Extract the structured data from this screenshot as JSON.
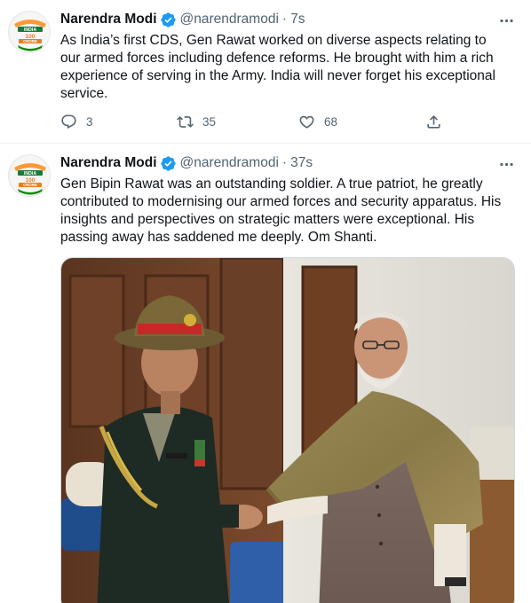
{
  "tweets": [
    {
      "author_name": "Narendra Modi",
      "handle": "@narendramodi",
      "separator": "·",
      "time": "7s",
      "text": "As India’s first CDS, Gen Rawat worked on diverse aspects relating to our armed forces including defence reforms. He brought with him a rich experience of serving in the Army. India will never forget his exceptional service.",
      "replies": "3",
      "retweets": "35",
      "likes": "68"
    },
    {
      "author_name": "Narendra Modi",
      "handle": "@narendramodi",
      "separator": "·",
      "time": "37s",
      "text": "Gen Bipin Rawat was an outstanding soldier. A true patriot, he greatly contributed to modernising our armed forces and security apparatus. His insights and perspectives on strategic matters were exceptional. His passing away has saddened me deeply. Om Shanti."
    }
  ],
  "avatar": {
    "line1": "INDIA",
    "line2": "100",
    "line3": "CRORE"
  },
  "colors": {
    "verified": "#1d9bf0",
    "secondary_text": "#536471",
    "border": "#eff3f4"
  },
  "icons": [
    "verified-badge-icon",
    "more-icon",
    "reply-icon",
    "retweet-icon",
    "like-icon",
    "share-icon"
  ]
}
